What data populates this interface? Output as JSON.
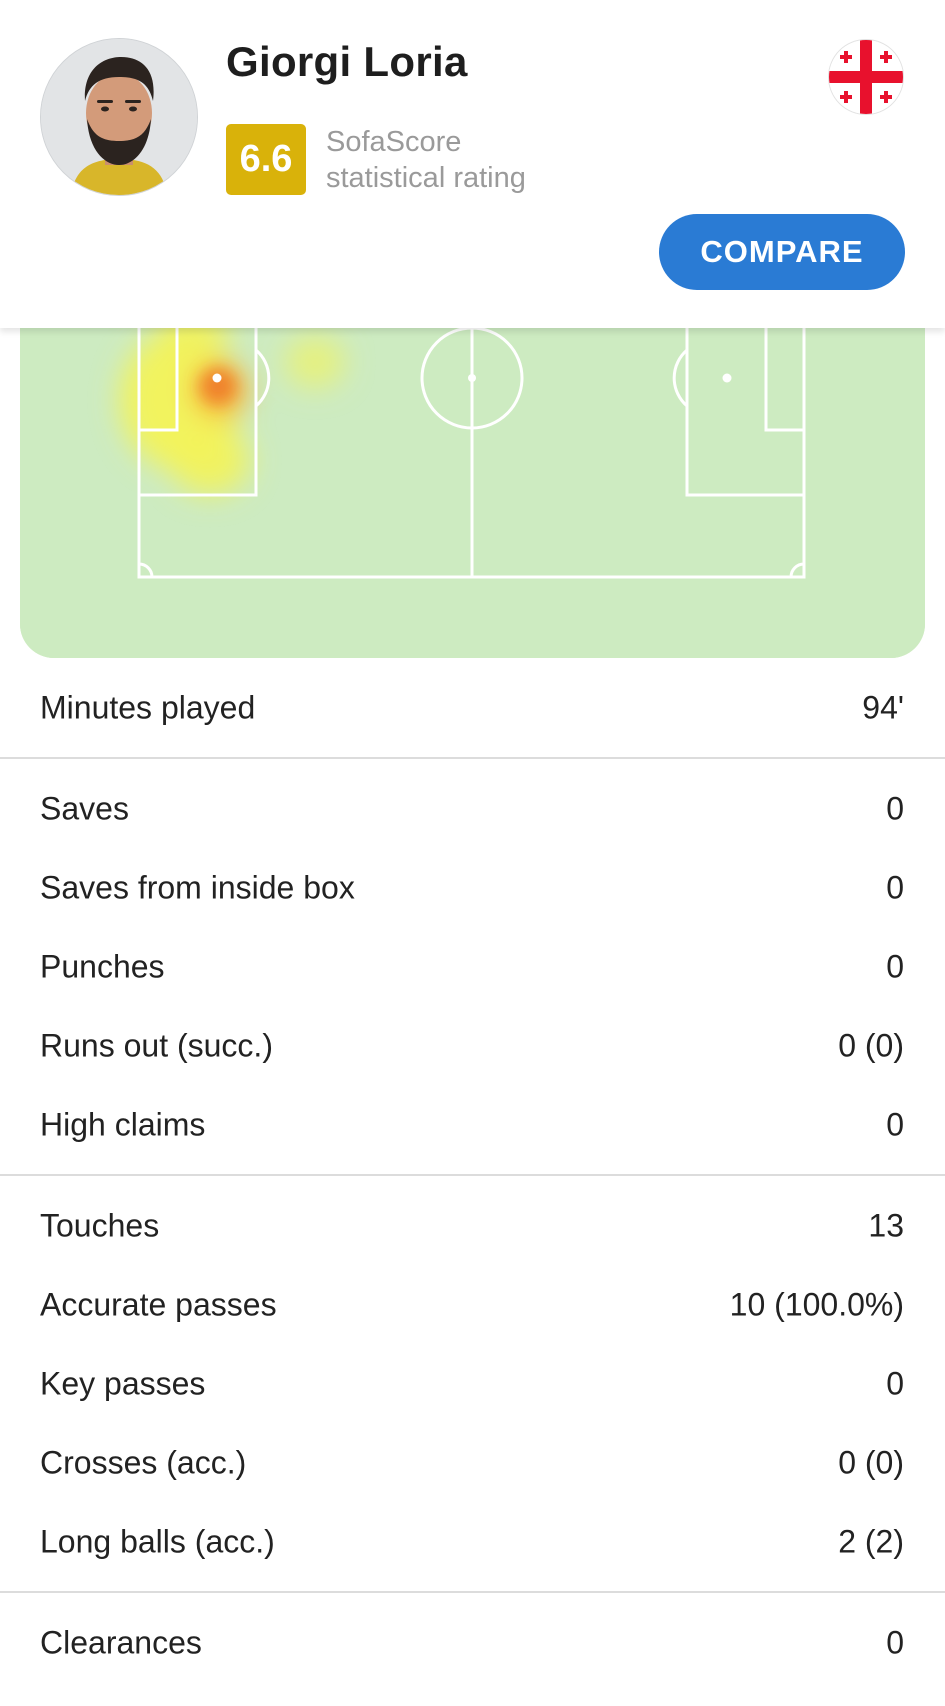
{
  "player": {
    "name": "Giorgi Loria",
    "rating": "6.6",
    "rating_label_line1": "SofaScore",
    "rating_label_line2": "statistical rating",
    "rating_color": "#d9b20a",
    "nationality_flag": "georgia-flag-icon"
  },
  "actions": {
    "compare_label": "COMPARE",
    "accent_color": "#2a7bd4"
  },
  "heatmap": {
    "pitch_color": "#cdebc1",
    "line_color": "#ffffff"
  },
  "stat_groups": [
    {
      "rows": [
        {
          "label": "Minutes played",
          "value": "94'"
        }
      ]
    },
    {
      "rows": [
        {
          "label": "Saves",
          "value": "0"
        },
        {
          "label": "Saves from inside box",
          "value": "0"
        },
        {
          "label": "Punches",
          "value": "0"
        },
        {
          "label": "Runs out (succ.)",
          "value": "0 (0)"
        },
        {
          "label": "High claims",
          "value": "0"
        }
      ]
    },
    {
      "rows": [
        {
          "label": "Touches",
          "value": "13"
        },
        {
          "label": "Accurate passes",
          "value": "10 (100.0%)"
        },
        {
          "label": "Key passes",
          "value": "0"
        },
        {
          "label": "Crosses (acc.)",
          "value": "0 (0)"
        },
        {
          "label": "Long balls (acc.)",
          "value": "2 (2)"
        }
      ]
    },
    {
      "rows": [
        {
          "label": "Clearances",
          "value": "0"
        }
      ]
    }
  ]
}
